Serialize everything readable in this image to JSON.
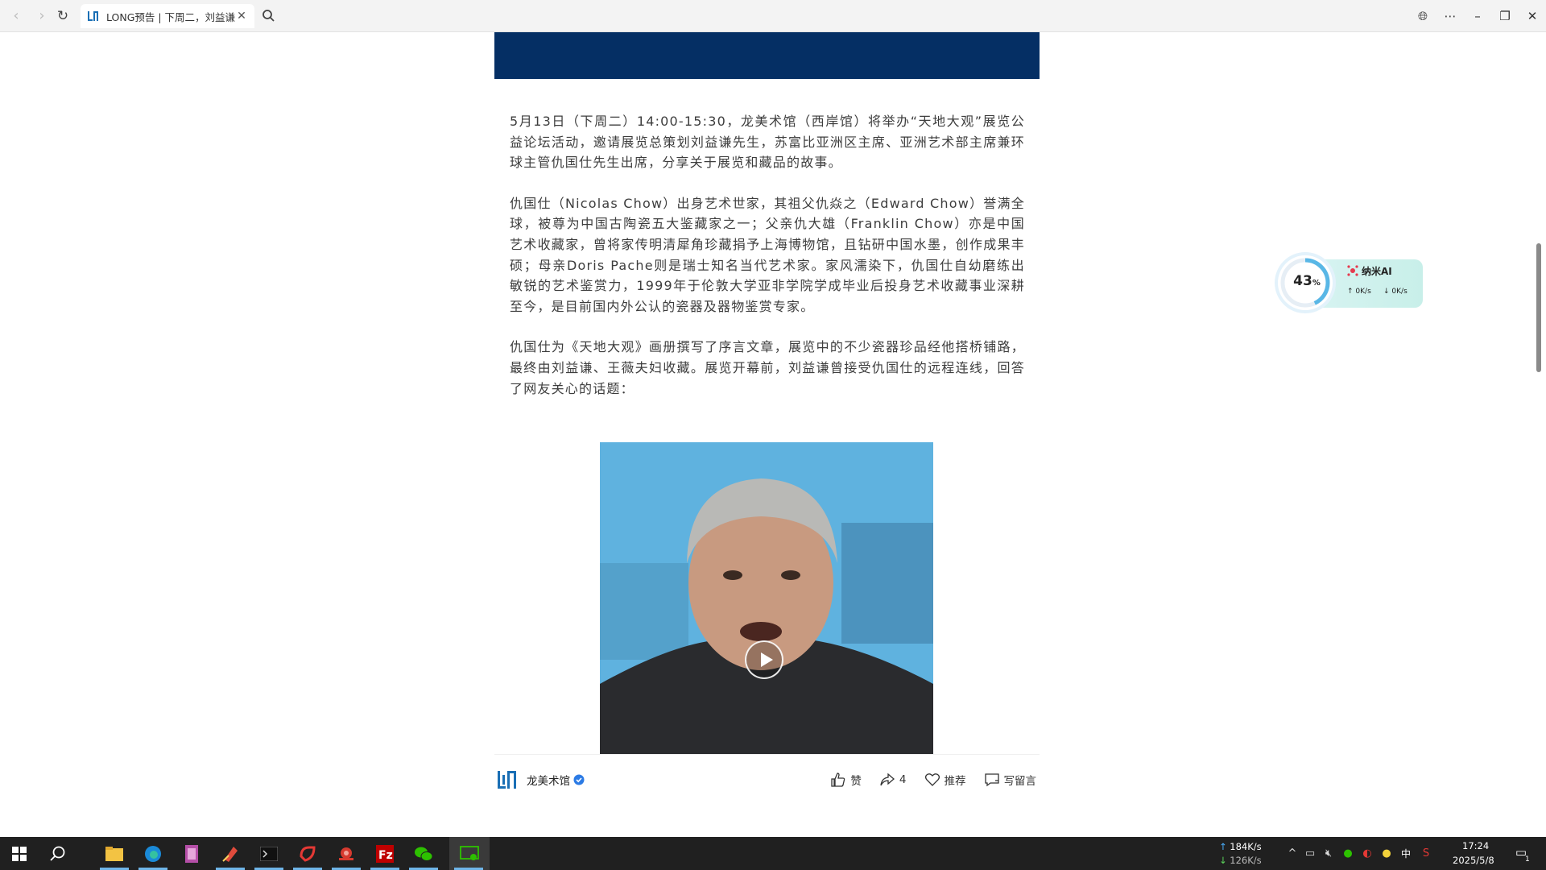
{
  "browser": {
    "tab_title": "LONG预告 | 下周二，刘益谦",
    "tab_close": "✕"
  },
  "article": {
    "paragraphs": [
      "5月13日（下周二）14:00-15:30，龙美术馆（西岸馆）将举办“天地大观”展览公益论坛活动，邀请展览总策划刘益谦先生，苏富比亚洲区主席、亚洲艺术部主席兼环球主管仇国仕先生出席，分享关于展览和藏品的故事。",
      "仇国仕（Nicolas Chow）出身艺术世家，其祖父仇焱之（Edward Chow）誉满全球，被尊为中国古陶瓷五大鉴藏家之一；父亲仇大雄（Franklin Chow）亦是中国艺术收藏家，曾将家传明清犀角珍藏捐予上海博物馆，且钻研中国水墨，创作成果丰硕；母亲Doris Pache则是瑞士知名当代艺术家。家风濡染下，仇国仕自幼磨练出敏锐的艺术鉴赏力，1999年于伦敦大学亚非学院学成毕业后投身艺术收藏事业深耕至今，是目前国内外公认的瓷器及器物鉴赏专家。",
      "仇国仕为《天地大观》画册撰写了序言文章，展览中的不少瓷器珍品经他搭桥铺路，最终由刘益谦、王薇夫妇收藏。展览开幕前，刘益谦曾接受仇国仕的远程连线，回答了网友关心的话题："
    ]
  },
  "footer": {
    "account_name": "龙美术馆",
    "like_label": "赞",
    "share_count": "4",
    "recommend_label": "推荐",
    "comment_label": "写留言"
  },
  "widget": {
    "percent": "43",
    "percent_unit": "%",
    "title": "纳米AI",
    "up_speed": "0K/s",
    "down_speed": "0K/s"
  },
  "taskbar": {
    "net_up": "184K/s",
    "net_down": "126K/s",
    "ime": "中",
    "time": "17:24",
    "date": "2025/5/8",
    "notification_count": "1"
  },
  "colors": {
    "banner": "#052f64",
    "brand": "#1a6fb5",
    "taskbar": "#202020"
  }
}
